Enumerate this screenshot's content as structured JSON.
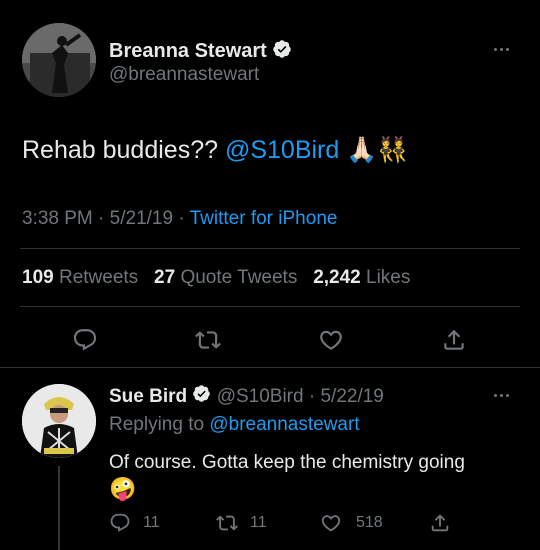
{
  "main_tweet": {
    "author_name": "Breanna Stewart",
    "author_handle": "@breannastewart",
    "text_prefix": "Rehab buddies?? ",
    "mention": "@S10Bird",
    "emoji": "🙏🏻👯",
    "time": "3:38 PM",
    "sep1": "·",
    "date": "5/21/19",
    "sep2": "·",
    "source": "Twitter for iPhone",
    "stats": {
      "retweets_count": "109",
      "retweets_label": "Retweets",
      "quotes_count": "27",
      "quotes_label": "Quote Tweets",
      "likes_count": "2,242",
      "likes_label": "Likes"
    }
  },
  "reply_tweet": {
    "author_name": "Sue Bird",
    "author_handle": "@S10Bird",
    "sep": "·",
    "date": "5/22/19",
    "replying_prefix": "Replying to",
    "replying_to": "@breannastewart",
    "text": "Of course. Gotta keep the chemistry going",
    "emoji": "🤪",
    "reply_count": "11",
    "retweet_count": "11",
    "like_count": "518"
  },
  "colors": {
    "background": "#000000",
    "text": "#e7e9ea",
    "muted": "#71767b",
    "accent": "#1d9bf0",
    "divider": "#2f3336"
  }
}
